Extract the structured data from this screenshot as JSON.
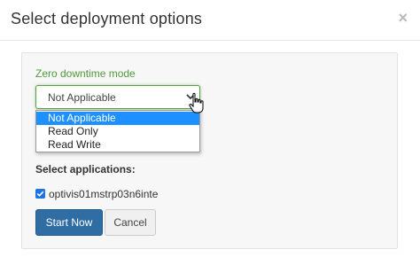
{
  "dialog": {
    "title": "Select deployment options",
    "close_symbol": "×"
  },
  "zero_downtime": {
    "label": "Zero downtime mode",
    "selected_value": "Not Applicable",
    "options": [
      "Not Applicable",
      "Read Only",
      "Read Write"
    ],
    "highlighted_option": "Not Applicable"
  },
  "applications": {
    "label": "Select applications:",
    "items": [
      {
        "name": "optivis01mstrp03n6inte",
        "checked": true
      }
    ]
  },
  "actions": {
    "start_label": "Start Now",
    "cancel_label": "Cancel"
  },
  "icons": {
    "close": "close-icon",
    "dropdown_arrow": "chevron-down-icon",
    "cursor": "hand-pointer-icon",
    "checkbox": "checkbox-checked-icon"
  },
  "colors": {
    "field_label": "#4f9a3a",
    "focus_border": "#58a043",
    "option_highlight": "#1e90ff",
    "primary_button": "#2f6da3",
    "checkbox": "#1a73e8"
  }
}
